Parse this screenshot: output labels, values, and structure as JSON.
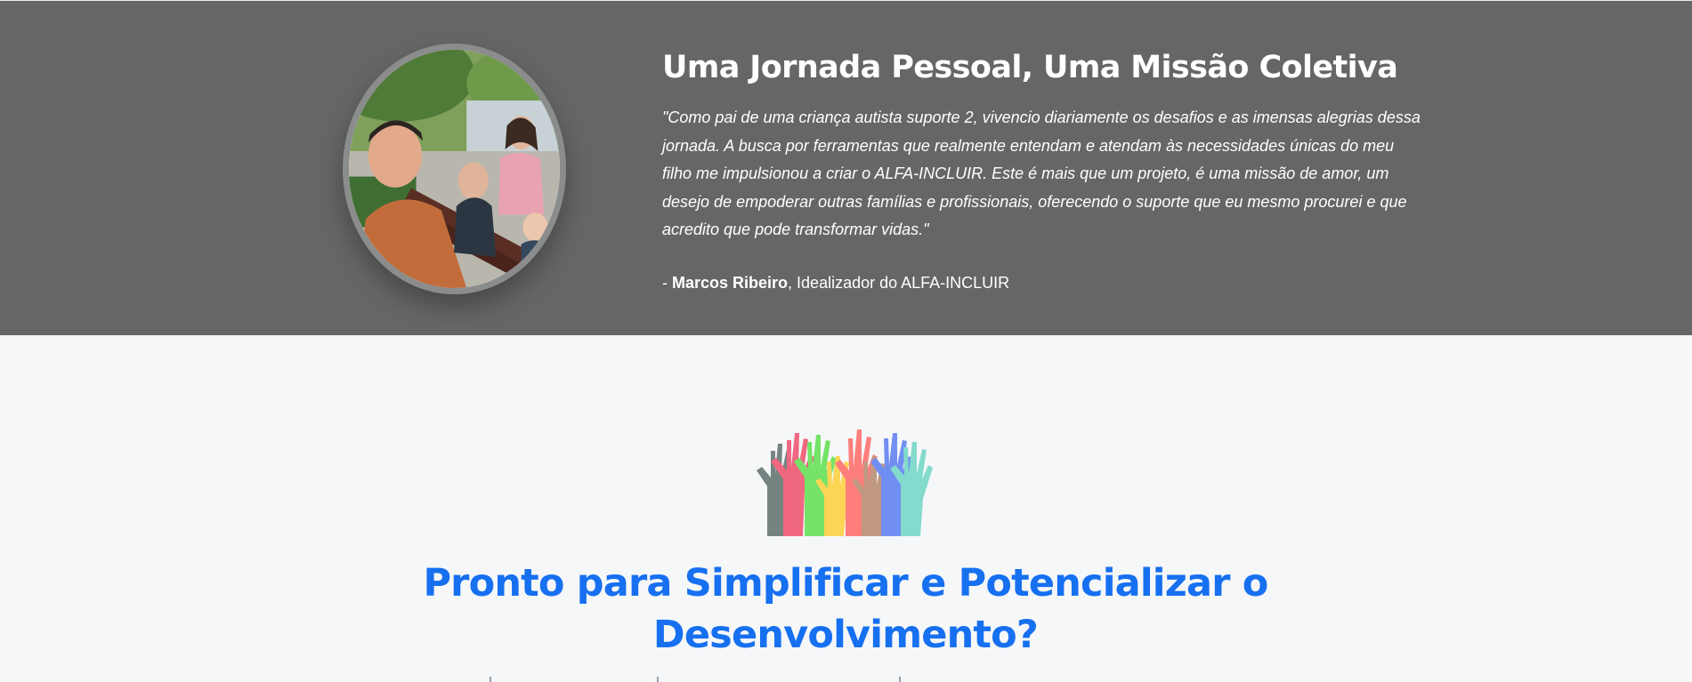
{
  "testimonial": {
    "title": "Uma Jornada Pessoal, Uma Missão Coletiva",
    "quote": "\"Como pai de uma criança autista suporte 2, vivencio diariamente os desafios e as imensas alegrias dessa jornada. A busca por ferramentas que realmente entendam e atendam às necessidades únicas do meu filho me impulsionou a criar o ALFA-INCLUIR. Este é mais que um projeto, é uma missão de amor, um desejo de empoderar outras famílias e profissionais, oferecendo o suporte que eu mesmo procurei e que acredito que pode transformar vidas.\"",
    "author_prefix": "- ",
    "author_name": "Marcos Ribeiro",
    "author_role": ", Idealizador do ALFA-INCLUIR",
    "photo": "family-photo"
  },
  "cta": {
    "illustration": "raised-hands-illustration",
    "heading_line1": "Pronto para Simplificar e Potencializar o",
    "heading_line2": "Desenvolvimento?"
  },
  "colors": {
    "testimonial_background": "#656766",
    "page_background": "#f6f7f9",
    "heading_blue": "#1670f0",
    "text_white": "#ffffff"
  }
}
